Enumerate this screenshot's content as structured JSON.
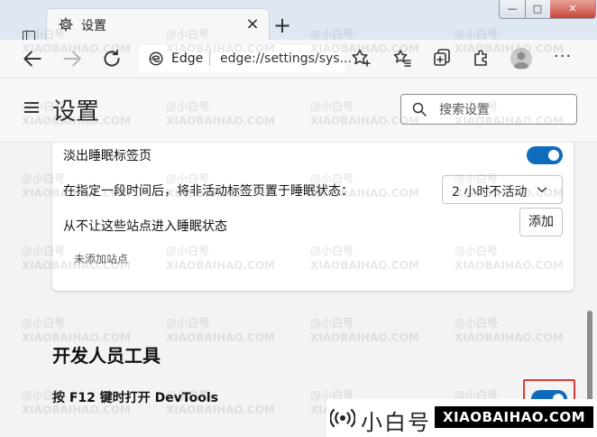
{
  "browser": {
    "tab": {
      "title": "设置",
      "close_glyph": "×"
    },
    "new_tab_glyph": "+",
    "window_buttons": {
      "minimize": "—",
      "maximize": "□",
      "close": "✕"
    },
    "address": {
      "site_label": "Edge",
      "url": "edge://settings/sys..."
    },
    "more_glyph": "···"
  },
  "settings": {
    "title": "设置",
    "search": {
      "placeholder": "搜索设置"
    },
    "sleeping_tabs": {
      "fade_label": "淡出睡眠标签页",
      "fade_enabled": true,
      "timeout_label": "在指定一段时间后，将非活动标签页置于睡眠状态：",
      "timeout_value": "2 小时不活动",
      "exclude_label": "从不让这些站点进入睡眠状态",
      "add_button": "添加",
      "empty_note": "未添加站点"
    },
    "developer_tools": {
      "section_title": "开发人员工具",
      "f12_label": "按 F12 键时打开 DevTools",
      "f12_enabled": true
    }
  },
  "watermark": {
    "cn": "小白号",
    "en": "XIAOBAIHAO.COM",
    "tile_cn": "@小白号",
    "tile_en": "XIAOBAIHAO.COM"
  },
  "colors": {
    "accent": "#0f6cbd",
    "highlight_border": "#e03a3a"
  },
  "icons": [
    "tab-actions-icon",
    "settings-gear-icon",
    "back-arrow-icon",
    "forward-arrow-icon",
    "refresh-icon",
    "edge-logo-icon",
    "add-favorite-icon",
    "favorites-icon",
    "collections-icon",
    "extensions-icon",
    "search-icon",
    "chevron-down-icon",
    "hamburger-menu-icon"
  ]
}
